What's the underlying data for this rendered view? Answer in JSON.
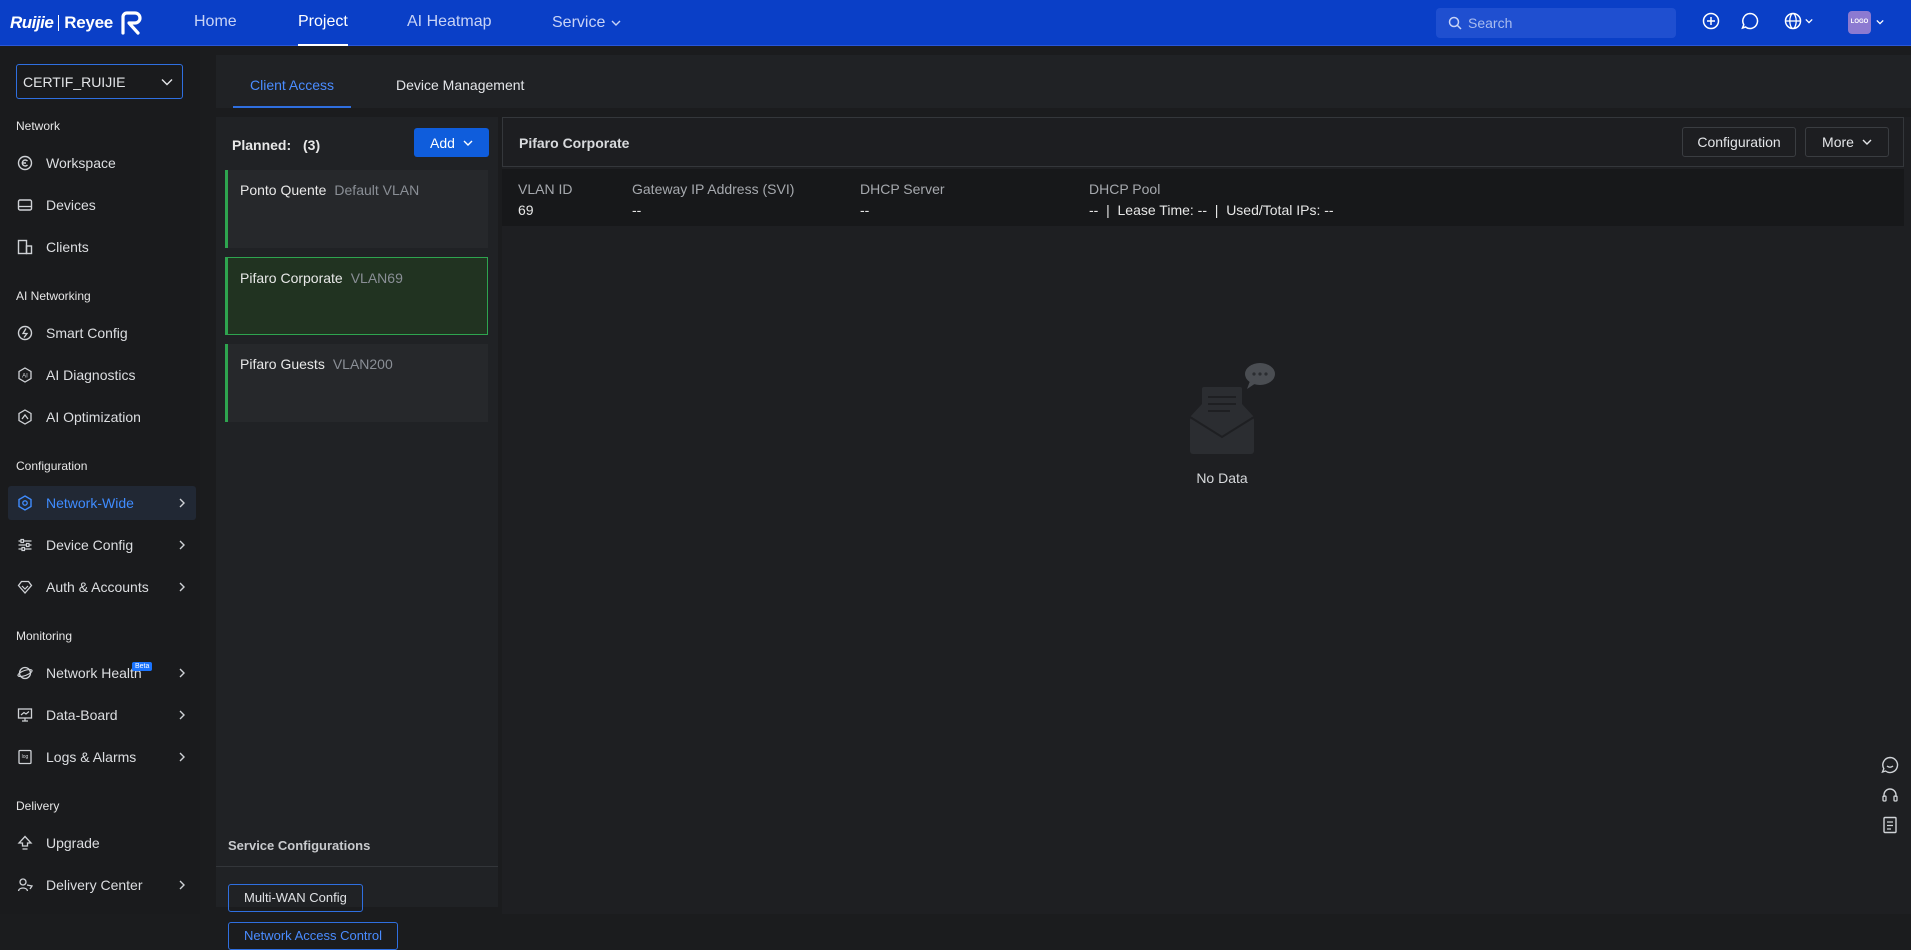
{
  "header": {
    "logo_brand": "Ruijie",
    "logo_sub": "Reyee",
    "nav": [
      {
        "label": "Home"
      },
      {
        "label": "Project"
      },
      {
        "label": "AI Heatmap"
      },
      {
        "label": "Service"
      }
    ],
    "search_placeholder": "Search",
    "avatar_text": "LOGO"
  },
  "sidebar": {
    "project_name": "CERTIF_RUIJIE",
    "sections": {
      "network": "Network",
      "ai": "AI Networking",
      "config": "Configuration",
      "monitoring": "Monitoring",
      "delivery": "Delivery"
    },
    "items": {
      "workspace": "Workspace",
      "devices": "Devices",
      "clients": "Clients",
      "smart_config": "Smart Config",
      "ai_diagnostics": "AI Diagnostics",
      "ai_optimization": "AI Optimization",
      "network_wide": "Network-Wide",
      "device_config": "Device Config",
      "auth_accounts": "Auth & Accounts",
      "network_health": "Network Health",
      "network_health_badge": "Beta",
      "data_board": "Data-Board",
      "logs_alarms": "Logs & Alarms",
      "upgrade": "Upgrade",
      "delivery_center": "Delivery Center"
    }
  },
  "tabs": {
    "client_access": "Client Access",
    "device_management": "Device Management"
  },
  "planned": {
    "label": "Planned:",
    "count": "(3)",
    "add_label": "Add",
    "vlans": [
      {
        "name": "Ponto Quente",
        "vlan": "Default VLAN"
      },
      {
        "name": "Pifaro Corporate",
        "vlan": "VLAN69"
      },
      {
        "name": "Pifaro Guests",
        "vlan": "VLAN200"
      }
    ]
  },
  "service": {
    "title": "Service Configurations",
    "multi_wan": "Multi-WAN Config",
    "nac": "Network Access Control"
  },
  "detail": {
    "title": "Pifaro Corporate",
    "config_btn": "Configuration",
    "more_btn": "More",
    "headers": {
      "vlan_id": "VLAN ID",
      "gateway": "Gateway IP Address (SVI)",
      "dhcp_server": "DHCP Server",
      "dhcp_pool": "DHCP Pool"
    },
    "values": {
      "vlan_id": "69",
      "gateway": "--",
      "dhcp_server": "--",
      "dhcp_pool": "--  |  Lease Time: --  |  Used/Total IPs: --"
    },
    "empty_text": "No Data"
  }
}
